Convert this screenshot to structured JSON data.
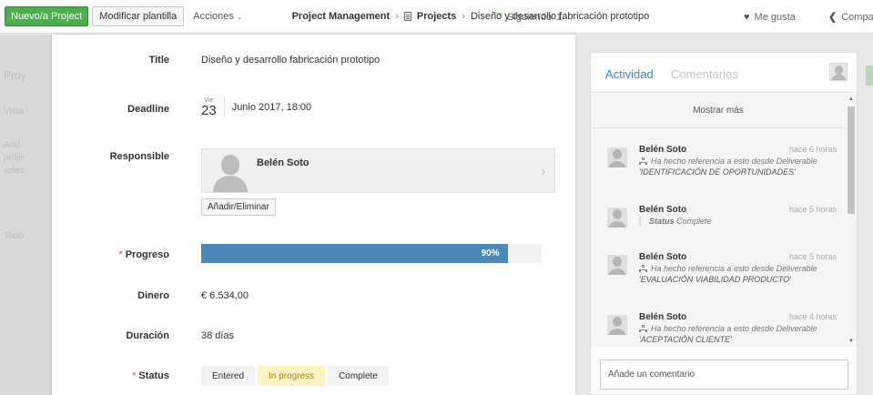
{
  "toolbar": {
    "new_project": "Nuevo/a Project",
    "modify_template": "Modificar plantilla",
    "actions": "Acciones",
    "follow": "Siguiendo",
    "follow_count": "1",
    "like": "Me gusta",
    "share": "Compar"
  },
  "breadcrumb": {
    "root": "Project Management",
    "section": "Projects",
    "current": "Diseño y desarrollo fabricación prototipo"
  },
  "background": {
    "items": [
      "Proy",
      "Vista",
      "Add",
      "proje",
      "selec",
      "Todo"
    ]
  },
  "form": {
    "title_label": "Title",
    "title_value": "Diseño y desarrollo fabricación prototipo",
    "deadline_label": "Deadline",
    "deadline_dow": "Vie",
    "deadline_day": "23",
    "deadline_rest": "Junio 2017, 18:00",
    "responsible_label": "Responsible",
    "responsible_name": "Belén Soto",
    "add_remove": "Añadir/Eliminar",
    "progress_label": "Progreso",
    "progress_value": 0.9,
    "progress_text": "90%",
    "money_label": "Dinero",
    "money_value": "€ 6.534,00",
    "duration_label": "Duración",
    "duration_value": "38 días",
    "status_label": "Status",
    "status_options": [
      "Entered",
      "In progress",
      "Complete"
    ],
    "status_selected": "In progress"
  },
  "activity": {
    "tab_activity": "Actividad",
    "tab_comments": "Comentarios",
    "show_more": "Mostrar más",
    "entries": [
      {
        "name": "Belén Soto",
        "time": "hace 6 horas",
        "text": "Ha hecho referencia a esto desde Deliverable",
        "ref": "'IDENTIFICACIÓN DE OPORTUNIDADES'"
      },
      {
        "name": "Belén Soto",
        "time": "hace 5 horas",
        "status_key": "Status",
        "status_value": "Complete"
      },
      {
        "name": "Belén Soto",
        "time": "hace 5 horas",
        "text": "Ha hecho referencia a esto desde Deliverable",
        "ref": "'EVALUACIÓN VIABILIDAD PRODUCTO'"
      },
      {
        "name": "Belén Soto",
        "time": "hace 4 horas",
        "text": "Ha hecho referencia a esto desde Deliverable",
        "ref": "'ACEPTACIÓN CLIENTE'"
      }
    ],
    "comment_placeholder": "Añade un comentario"
  },
  "colors": {
    "accent_green": "#4cae4c",
    "progress_blue": "#4a88b8",
    "tab_active": "#3a87c8",
    "status_active_bg": "#fdf2c4"
  }
}
